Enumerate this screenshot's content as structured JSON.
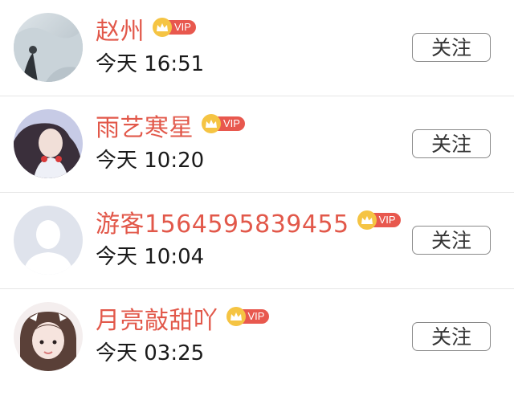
{
  "users": [
    {
      "name": "赵州",
      "time": "今天 16:51",
      "vip": "VIP",
      "follow": "关注",
      "avatar": "photo-avatar-icon"
    },
    {
      "name": "雨艺寒星",
      "time": "今天 10:20",
      "vip": "VIP",
      "follow": "关注",
      "avatar": "photo-avatar-icon"
    },
    {
      "name": "游客1564595839455",
      "time": "今天 10:04",
      "vip": "VIP",
      "follow": "关注",
      "avatar": "default-avatar-icon"
    },
    {
      "name": "月亮敲甜吖",
      "time": "今天 03:25",
      "vip": "VIP",
      "follow": "关注",
      "avatar": "photo-avatar-icon"
    }
  ],
  "colors": {
    "name": "#e2584a",
    "vip_badge": "#e8584e",
    "crown": "#f5c443",
    "divider": "#e6e6e6"
  }
}
